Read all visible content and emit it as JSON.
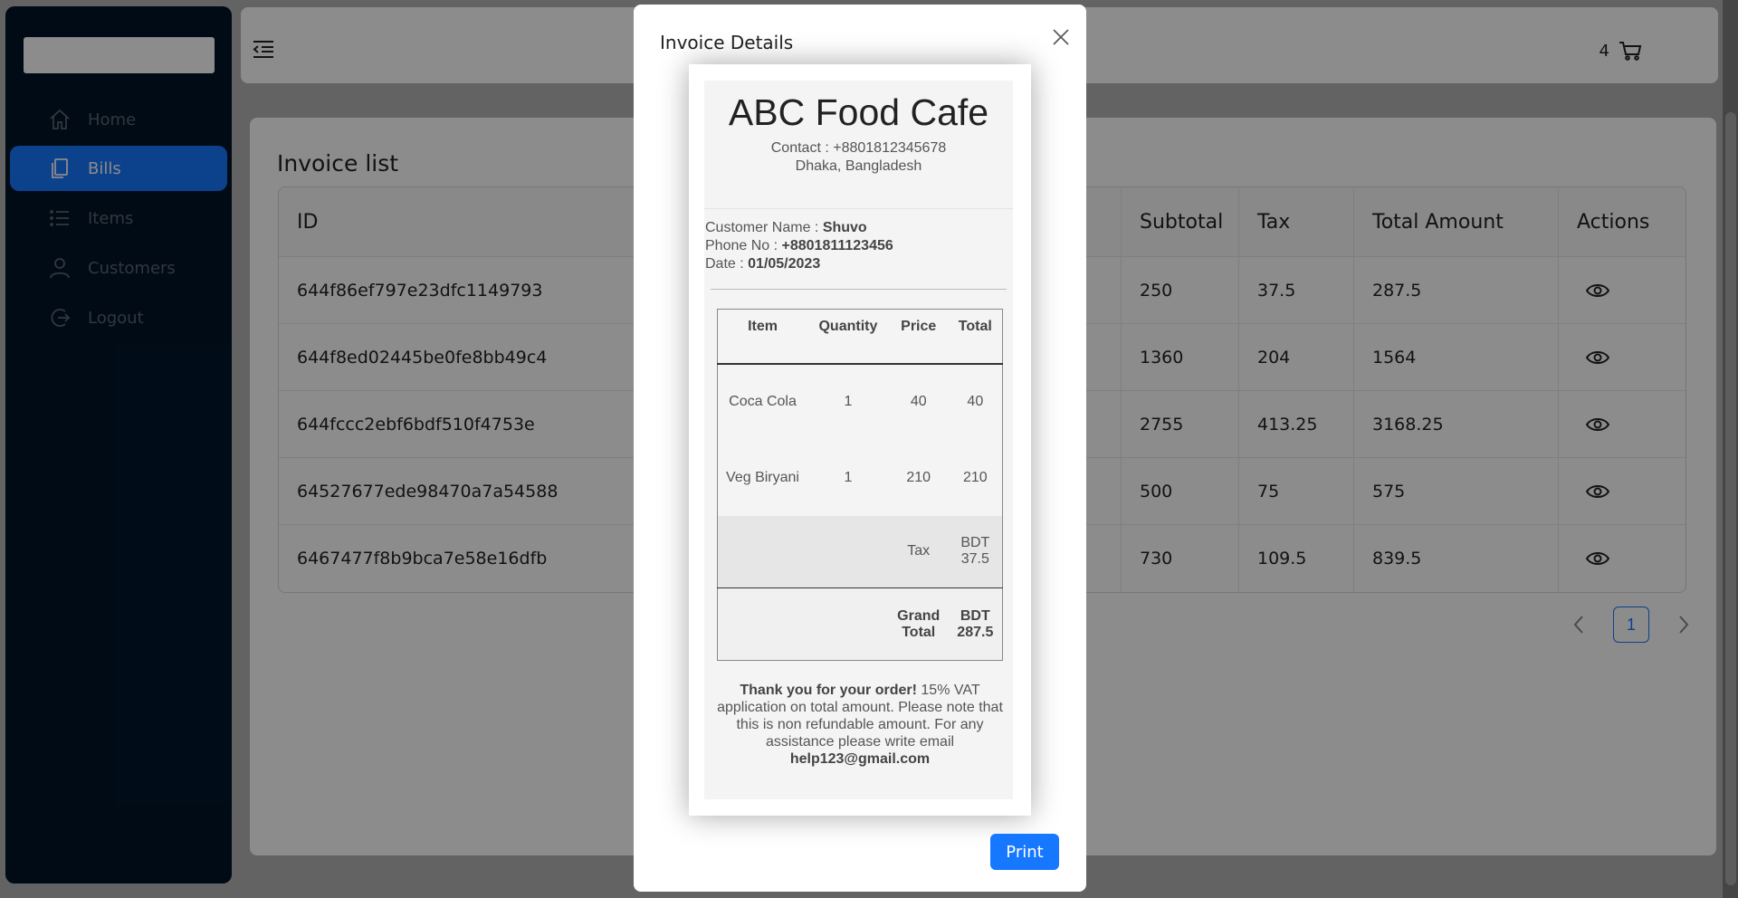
{
  "sidebar": {
    "items": [
      {
        "label": "Home",
        "icon": "home-icon"
      },
      {
        "label": "Bills",
        "icon": "bills-icon"
      },
      {
        "label": "Items",
        "icon": "list-icon"
      },
      {
        "label": "Customers",
        "icon": "user-icon"
      },
      {
        "label": "Logout",
        "icon": "logout-icon"
      }
    ],
    "active_index": 1
  },
  "header": {
    "cart_count": "4"
  },
  "main": {
    "title": "Invoice list",
    "columns": [
      "ID",
      "Subtotal",
      "Tax",
      "Total Amount",
      "Actions"
    ],
    "rows": [
      {
        "id": "644f86ef797e23dfc1149793",
        "subtotal": "250",
        "tax": "37.5",
        "total": "287.5"
      },
      {
        "id": "644f8ed02445be0fe8bb49c4",
        "subtotal": "1360",
        "tax": "204",
        "total": "1564"
      },
      {
        "id": "644fccc2ebf6bdf510f4753e",
        "subtotal": "2755",
        "tax": "413.25",
        "total": "3168.25"
      },
      {
        "id": "64527677ede98470a7a54588",
        "subtotal": "500",
        "tax": "75",
        "total": "575"
      },
      {
        "id": "6467477f8b9bca7e58e16dfb",
        "subtotal": "730",
        "tax": "109.5",
        "total": "839.5"
      }
    ],
    "pagination": {
      "current": "1"
    }
  },
  "modal": {
    "title": "Invoice Details",
    "print_label": "Print",
    "receipt": {
      "cafe_name": "ABC Food Cafe",
      "contact": "Contact : +8801812345678",
      "address": "Dhaka, Bangladesh",
      "customer_label": "Customer Name : ",
      "customer_name": "Shuvo",
      "phone_label": "Phone No : ",
      "phone": "+8801811123456",
      "date_label": "Date : ",
      "date": "01/05/2023",
      "columns": [
        "Item",
        "Quantity",
        "Price",
        "Total"
      ],
      "items": [
        {
          "name": "Coca Cola",
          "qty": "1",
          "price": "40",
          "total": "40"
        },
        {
          "name": "Veg Biryani",
          "qty": "1",
          "price": "210",
          "total": "210"
        }
      ],
      "tax_label": "Tax",
      "tax_value": "BDT 37.5",
      "grand_label": "Grand Total",
      "grand_value": "BDT 287.5",
      "thanks": "Thank you for your order!",
      "footer_text": " 15% VAT application on total amount. Please note that this is non refundable amount. For any assistance please write email ",
      "email": "help123@gmail.com"
    }
  },
  "colors": {
    "sidebar_bg": "#001529",
    "accent": "#1677ff"
  }
}
